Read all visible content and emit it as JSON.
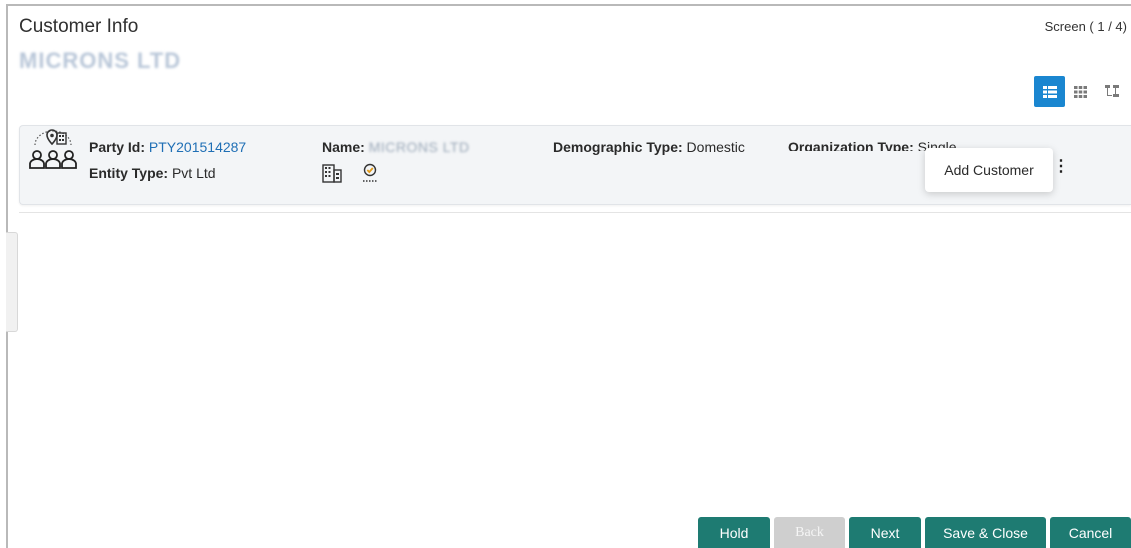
{
  "header": {
    "title": "Customer Info",
    "company_name": "MICRONS LTD",
    "screen_counter": "Screen ( 1 / 4)"
  },
  "view_switch": {
    "options": [
      "list-view",
      "grid-view",
      "tree-view"
    ],
    "active": "list-view",
    "accent_color": "#1a86d0"
  },
  "party_card": {
    "icon": "party-group-icon",
    "party_id_label": "Party Id:",
    "party_id_value": "PTY201514287",
    "entity_type_label": "Entity Type:",
    "entity_type_value": "Pvt Ltd",
    "name_label": "Name:",
    "name_value": "MICRONS LTD",
    "demographic_label": "Demographic Type:",
    "demographic_value": "Domestic",
    "org_type_label": "Organization Type:",
    "org_type_value": "Single",
    "badge_icons": [
      "building-icon",
      "verified-icon"
    ]
  },
  "context_menu": {
    "items": [
      "Add Customer"
    ]
  },
  "footer": {
    "hold_label": "Hold",
    "back_label": "Back",
    "next_label": "Next",
    "save_close_label": "Save & Close",
    "cancel_label": "Cancel",
    "primary_color": "#1e7b72",
    "disabled_color": "#cfcfcf"
  }
}
